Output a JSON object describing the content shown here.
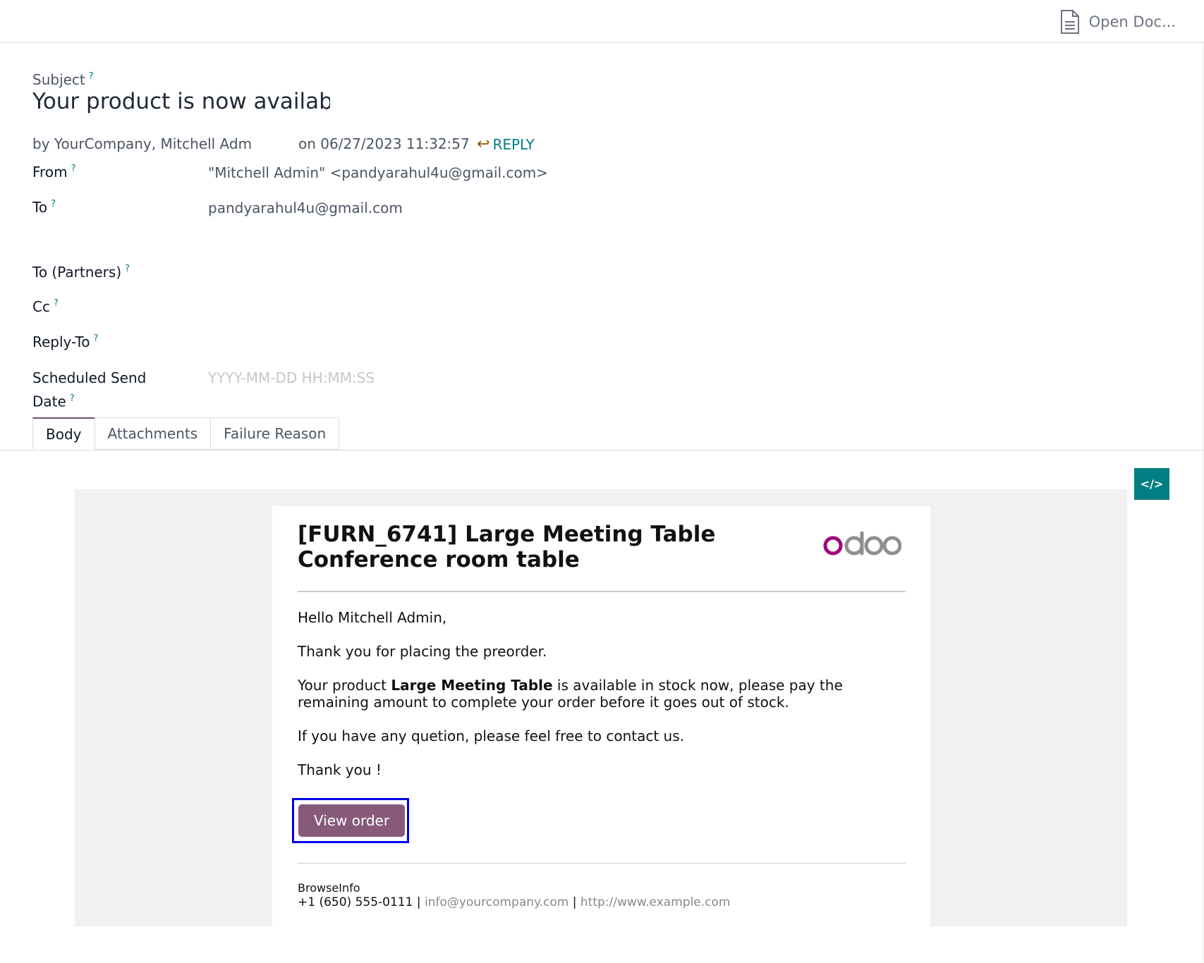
{
  "topbar": {
    "open_doc_label": "Open Doc..."
  },
  "message": {
    "subject_label": "Subject",
    "subject_value": "Your product is now available",
    "by_line": "by YourCompany, Mitchell Admin",
    "date_line": "on 06/27/2023 11:32:57",
    "reply_label": "REPLY"
  },
  "fields": {
    "from_label": "From",
    "from_value": "\"Mitchell Admin\" <pandyarahul4u@gmail.com>",
    "to_label": "To",
    "to_value": "pandyarahul4u@gmail.com",
    "to_partners_label": "To (Partners)",
    "cc_label": "Cc",
    "reply_to_label": "Reply-To",
    "scheduled_label_1": "Scheduled Send",
    "scheduled_label_2": "Date",
    "scheduled_placeholder": "YYYY-MM-DD HH:MM:SS",
    "help_mark": "?"
  },
  "tabs": [
    {
      "label": "Body",
      "active": true
    },
    {
      "label": "Attachments",
      "active": false
    },
    {
      "label": "Failure Reason",
      "active": false
    }
  ],
  "code_button": {
    "label": "</>"
  },
  "email": {
    "title_line1": "[FURN_6741] Large Meeting Table",
    "title_line2": "Conference room table",
    "logo_text": "odoo",
    "greeting": "Hello Mitchell Admin,",
    "thanks_line": "Thank you for placing the preorder.",
    "product_prefix": "Your product ",
    "product_name": "Large Meeting Table",
    "product_suffix": " is available in stock now, please pay the remaining amount to complete your order before it goes out of stock.",
    "question_line": "If you have any quetion, please feel free to contact us.",
    "closing": "Thank you !",
    "button_label": "View order",
    "footer_company": "BrowseInfo",
    "footer_phone": "+1 (650) 555-0111",
    "footer_sep": " | ",
    "footer_email": "info@yourcompany.com",
    "footer_url": "http://www.example.com"
  },
  "colors": {
    "accent": "#017e84",
    "button": "#875a7b",
    "logo_o": "#a3007c",
    "logo_rest": "#8f8f8f"
  }
}
